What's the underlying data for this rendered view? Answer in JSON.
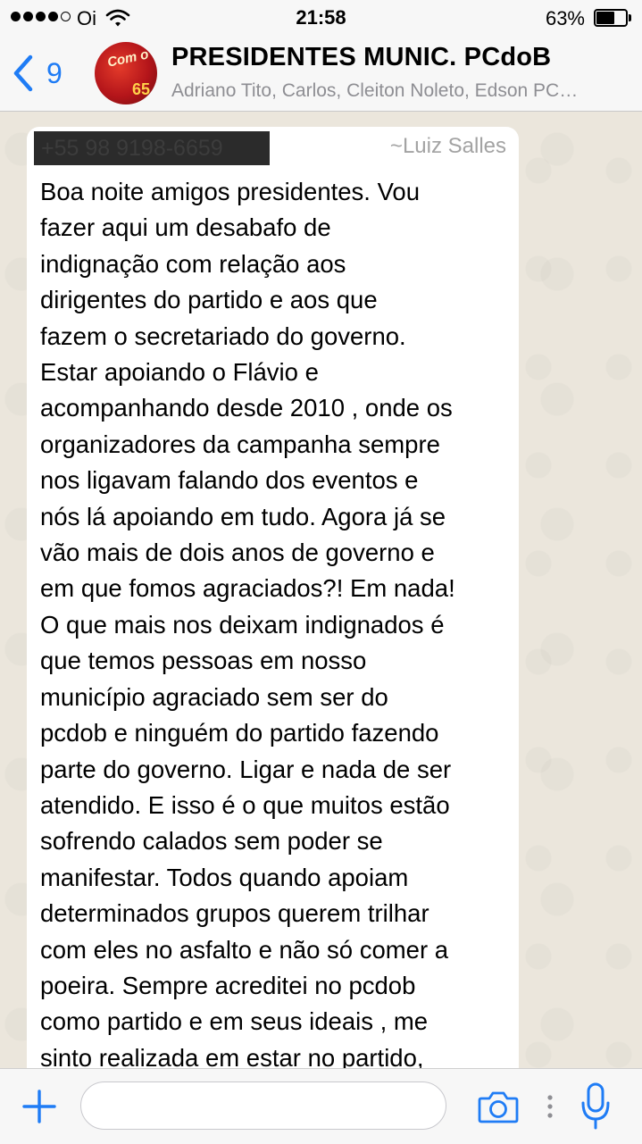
{
  "status_bar": {
    "signal_icon": "signal-dots-icon",
    "signal_bars": 4,
    "signal_max": 5,
    "carrier": "Oi",
    "wifi_icon": "wifi-icon",
    "time": "21:58",
    "battery_percent": "63%",
    "battery_level": 0.63,
    "battery_icon": "battery-icon"
  },
  "header": {
    "back_icon": "chevron-left-icon",
    "back_count": "9",
    "avatar_text_top": "Com o",
    "avatar_text_bottom": "65",
    "title": "PRESIDENTES MUNIC. PCdoB",
    "members": "Adriano Tito, Carlos, Cleiton Noleto, Edson PC…"
  },
  "message": {
    "sender_phone": "+55 98 9198-6659",
    "sender_name": "~Luiz Salles",
    "text": "Boa noite amigos presidentes. Vou\nfazer aqui um desabafo de\nindignação com relação aos\ndirigentes do partido e aos que\nfazem o secretariado do governo.\nEstar apoiando o Flávio e\nacompanhando desde 2010 , onde os\norganizadores da campanha sempre\nnos ligavam falando dos eventos  e\nnós lá apoiando em tudo. Agora já se\nvão mais de dois anos de governo e\nem que fomos agraciados?! Em nada!\nO que mais nos deixam indignados é\nque temos pessoas em nosso\nmunicípio agraciado sem ser do\npcdob e ninguém do partido fazendo\nparte do governo. Ligar e nada de ser\natendido. E isso é o que muitos estão\nsofrendo calados sem poder se\nmanifestar. Todos quando apoiam\ndeterminados grupos querem trilhar\ncom eles no asfalto e não só comer a\npoeira. Sempre acreditei no pcdob\ncomo partido e em seus ideais , me\nsinto realizada em estar no partido,"
  },
  "input_bar": {
    "plus_icon": "plus-icon",
    "input_value": "",
    "camera_icon": "camera-icon",
    "more_icon": "vertical-dots-icon",
    "mic_icon": "microphone-icon"
  },
  "colors": {
    "accent": "#1f7cf5",
    "chat_background": "#ebe6dc",
    "bubble": "#ffffff",
    "secondary_text": "#8e8e93"
  }
}
